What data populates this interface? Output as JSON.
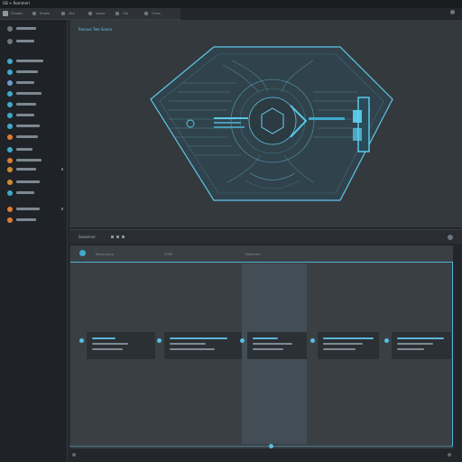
{
  "titlebar": {
    "title": "GB + Rommerl"
  },
  "toolbar": {
    "items": [
      "Cimaas",
      "Eroom",
      "Alte",
      "Aosso",
      "Cisl",
      "Cmsn"
    ]
  },
  "sidebar": {
    "items": [
      {
        "icon": "folder-icon",
        "color": "#6c757d"
      },
      {
        "icon": "file-icon",
        "color": "#6c757d"
      },
      {
        "icon": "circle-icon",
        "color": "#3fa9cc"
      },
      {
        "icon": "circle-icon",
        "color": "#3fa9cc"
      },
      {
        "icon": "user-icon",
        "color": "#6c9bd2"
      },
      {
        "icon": "circle-icon",
        "color": "#3fa9cc"
      },
      {
        "icon": "circle-icon",
        "color": "#3fa9cc"
      },
      {
        "icon": "circle-icon",
        "color": "#3fa9cc"
      },
      {
        "icon": "circle-icon",
        "color": "#3fa9cc"
      },
      {
        "icon": "warning-icon",
        "color": "#e07b2e"
      },
      {
        "icon": "circle-icon",
        "color": "#3fa9cc"
      },
      {
        "icon": "alert-icon",
        "color": "#e07b2e"
      },
      {
        "icon": "circle-icon",
        "color": "#d08a30"
      },
      {
        "icon": "circle-icon",
        "color": "#d08a30"
      },
      {
        "icon": "circle-icon",
        "color": "#3fa9cc"
      },
      {
        "icon": "box-icon",
        "color": "#e07b2e"
      },
      {
        "icon": "box-icon",
        "color": "#e07b2e"
      }
    ]
  },
  "viewer": {
    "title": "Reoavo Twe Soaee"
  },
  "panel": {
    "header_title": "Seaonnor",
    "col_labels": [
      "Rosonoonia",
      "SORE",
      "Neeenaer"
    ]
  },
  "colors": {
    "accent": "#4fb2d6",
    "bg": "#23272b"
  }
}
